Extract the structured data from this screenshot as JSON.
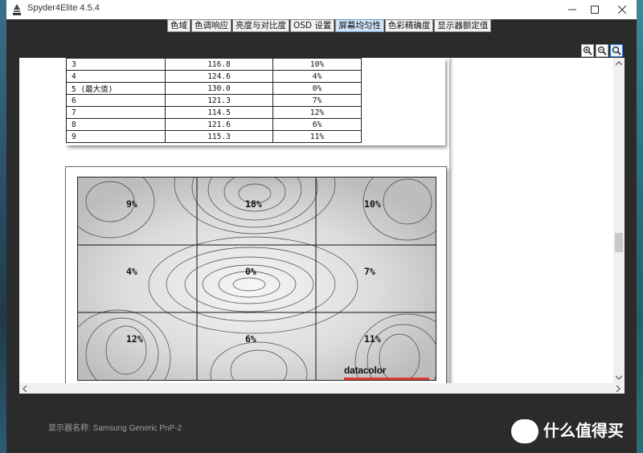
{
  "app": {
    "title": "Spyder4Elite 4.5.4"
  },
  "tabs": [
    "色域",
    "色调响应",
    "亮度与对比度",
    "OSD 设置",
    "屏幕均匀性",
    "色彩精确度",
    "显示器额定值"
  ],
  "active_tab_index": 4,
  "table": {
    "rows": [
      [
        "3",
        "116.8",
        "10%"
      ],
      [
        "4",
        "124.6",
        "4%"
      ],
      [
        "5 (最大值)",
        "130.0",
        "0%"
      ],
      [
        "6",
        "121.3",
        "7%"
      ],
      [
        "7",
        "114.5",
        "12%"
      ],
      [
        "8",
        "121.6",
        "6%"
      ],
      [
        "9",
        "115.3",
        "11%"
      ]
    ]
  },
  "uniformity_map": {
    "cells": [
      "9%",
      "18%",
      "10%",
      "4%",
      "0%",
      "7%",
      "12%",
      "6%",
      "11%"
    ]
  },
  "logo": {
    "text": "datacolor",
    "color": "#e03a32"
  },
  "footer": {
    "display_name": "显示器名称: Samsung Generic PnP-2"
  },
  "watermark": {
    "text": "什么值得买"
  },
  "icons": [
    "app-icon",
    "minimize-icon",
    "maximize-icon",
    "close-icon",
    "zoom-in-icon",
    "zoom-out-icon",
    "zoom-fit-icon"
  ]
}
